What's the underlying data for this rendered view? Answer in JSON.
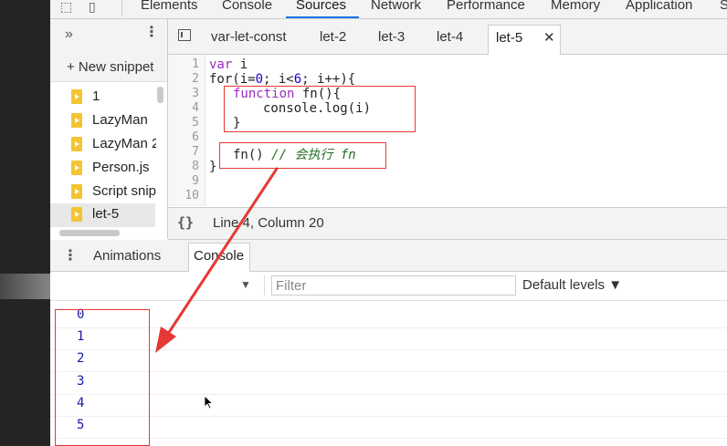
{
  "toolbar": {
    "tabs": [
      {
        "label": "Elements"
      },
      {
        "label": "Console"
      },
      {
        "label": "Sources"
      },
      {
        "label": "Network"
      },
      {
        "label": "Performance"
      },
      {
        "label": "Memory"
      },
      {
        "label": "Application"
      },
      {
        "label": "S"
      }
    ],
    "active_tab": "Sources"
  },
  "navigator": {
    "new_snippet_label": "+ New snippet",
    "items": [
      {
        "label": "1"
      },
      {
        "label": "LazyMan"
      },
      {
        "label": "LazyMan 2"
      },
      {
        "label": "Person.js"
      },
      {
        "label": "Script snip"
      },
      {
        "label": "let-5"
      }
    ],
    "selected": "let-5"
  },
  "editor": {
    "tabs": [
      {
        "label": "var-let-const"
      },
      {
        "label": "let-2"
      },
      {
        "label": "let-3"
      },
      {
        "label": "let-4"
      },
      {
        "label": "let-5"
      }
    ],
    "active_tab": "let-5",
    "line_numbers": [
      "1",
      "2",
      "3",
      "4",
      "5",
      "6",
      "7",
      "8",
      "9",
      "10"
    ],
    "code": {
      "l1_kw": "var",
      "l1_rest": " i",
      "l2_a": "for(i=",
      "l2_n1": "0",
      "l2_b": "; i<",
      "l2_n2": "6",
      "l2_c": "; i++){",
      "l3_kw": "function",
      "l3_rest": " fn(){",
      "l4": "console.log(i)",
      "l5": "}",
      "l7_call": "fn() ",
      "l7_comment": "// 会执行 fn",
      "l8": "}"
    }
  },
  "status": {
    "format_icon": "{}",
    "position": "Line 4, Column 20"
  },
  "drawer": {
    "tabs": [
      {
        "label": "Animations"
      },
      {
        "label": "Console"
      }
    ],
    "active_tab": "Console"
  },
  "console": {
    "filter_placeholder": "Filter",
    "levels_label": "Default levels ▼",
    "context_arrow": "▼",
    "output": [
      "0",
      "1",
      "2",
      "3",
      "4",
      "5"
    ]
  },
  "colors": {
    "annotation_red": "#e53935",
    "accent_blue": "#1a73e8",
    "snippet_yellow": "#f4c434"
  }
}
